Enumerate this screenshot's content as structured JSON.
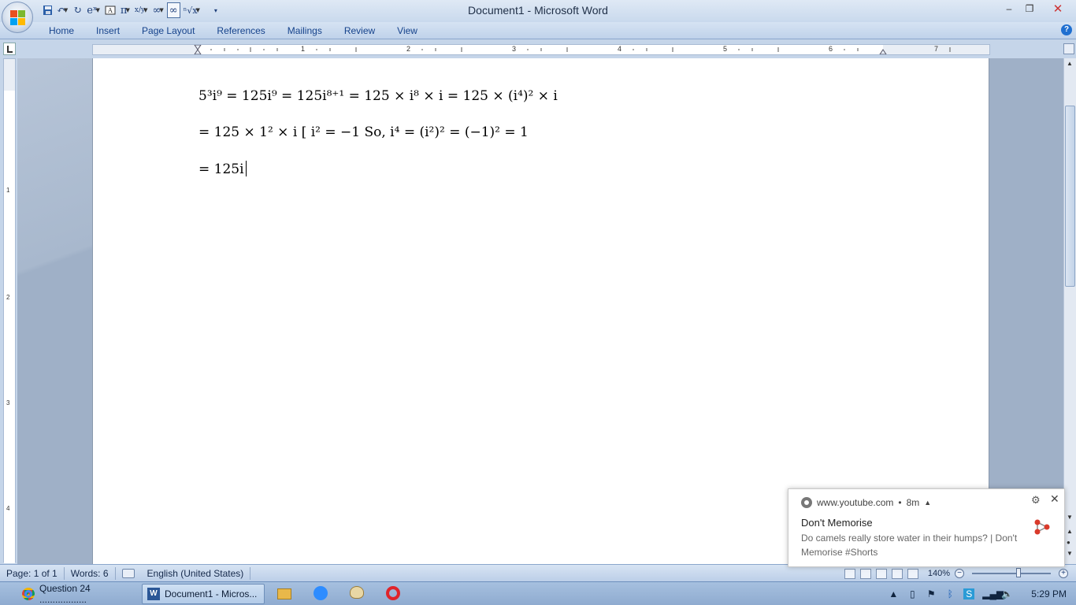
{
  "window": {
    "title": "Document1 - Microsoft Word",
    "minimize": "–",
    "restore": "❐",
    "close": "✕"
  },
  "quick_access": {
    "save": "💾",
    "undo": "↶",
    "redo": "↻",
    "exp": "eˣ",
    "pi": "π",
    "fraction": "x/y",
    "infinity": "∞",
    "radical": "ⁿ√x"
  },
  "ribbon": {
    "tabs": [
      "Home",
      "Insert",
      "Page Layout",
      "References",
      "Mailings",
      "Review",
      "View"
    ],
    "help": "?"
  },
  "ruler": {
    "labels": [
      "1",
      "2",
      "3",
      "4",
      "5",
      "6",
      "7"
    ],
    "vertical_labels": [
      "1",
      "2",
      "3",
      "4"
    ]
  },
  "document": {
    "lines": [
      "5³i⁹ = 125i⁹ = 125i⁸⁺¹ = 125 × i⁸ × i = 125 × (i⁴)² × i",
      "= 125 × 1² × i [ i² = −1 So, i⁴ = (i²)² = (−1)² = 1",
      "= 125i"
    ]
  },
  "statusbar": {
    "page": "Page: 1 of 1",
    "words": "Words: 6",
    "language": "English (United States)",
    "zoom": "140%",
    "zoom_fraction": 0.6
  },
  "taskbar": {
    "chrome_label": "Question 24 ..................",
    "word_label": "Document1 - Micros...",
    "clock": "5:29 PM"
  },
  "notification": {
    "source": "www.youtube.com",
    "age": "8m",
    "title": "Don't Memorise",
    "body": "Do camels really store water in their humps? | Don't Memorise #Shorts"
  },
  "colors": {
    "accent": "#15428b",
    "close_red": "#c33333"
  }
}
